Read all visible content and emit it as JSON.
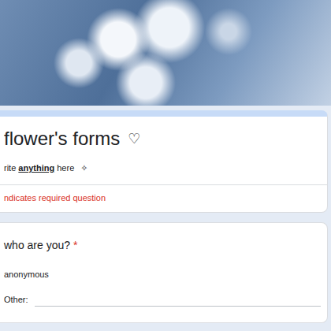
{
  "form": {
    "title": "flower's forms",
    "title_icon": "♡",
    "description": {
      "before": "rite ",
      "bold": "anything",
      "after": " here",
      "icon": "✧"
    },
    "required_note": "ndicates required question"
  },
  "questions": [
    {
      "title": "who are you?",
      "required_mark": "*",
      "options": [
        {
          "label": "anonymous",
          "kind": "option"
        },
        {
          "label": "Other:",
          "kind": "other"
        }
      ]
    }
  ]
}
